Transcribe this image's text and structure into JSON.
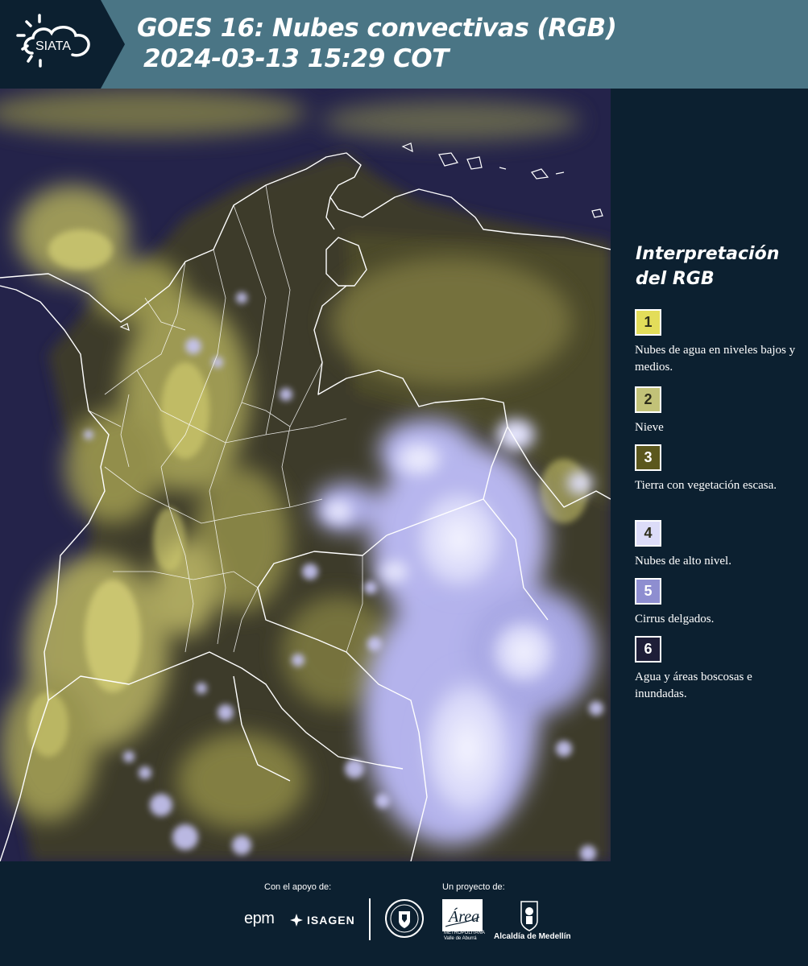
{
  "header": {
    "logo_text": "SIATA",
    "title": "GOES 16: Nubes convectivas (RGB)",
    "subtitle": "2024-03-13 15:29 COT"
  },
  "legend": {
    "title_line1": "Interpretación",
    "title_line2": "del RGB",
    "items": [
      {
        "number": "1",
        "label": "Nubes de agua en niveles bajos y medios.",
        "color": "#e3dd5a"
      },
      {
        "number": "2",
        "label": "Nieve",
        "color": "#c2c278"
      },
      {
        "number": "3",
        "label": "Tierra con vegetación escasa.",
        "color": "#5b571d"
      },
      {
        "number": "4",
        "label": "Nubes de alto nivel.",
        "color": "#dcdcf8"
      },
      {
        "number": "5",
        "label": "Cirrus delgados.",
        "color": "#8e8ed0"
      },
      {
        "number": "6",
        "label": "Agua y áreas boscosas e inundadas.",
        "color": "#1e1e38"
      }
    ]
  },
  "footer": {
    "support_label": "Con el apoyo de:",
    "project_label": "Un proyecto de:",
    "epm": "epm",
    "isagen": "ISAGEN",
    "area_logo": "Área",
    "area_sub_1": "METROPOLITANA",
    "area_sub_2": "Valle de Aburrá",
    "alcaldia": "Alcaldía de Medellín"
  },
  "colors": {
    "header_bg": "#4a7585",
    "page_bg": "#0c2030",
    "ocean": "#25244a",
    "low_cloud_yellow": "#c8c560",
    "high_cloud_lavender": "#d0d0f6"
  }
}
